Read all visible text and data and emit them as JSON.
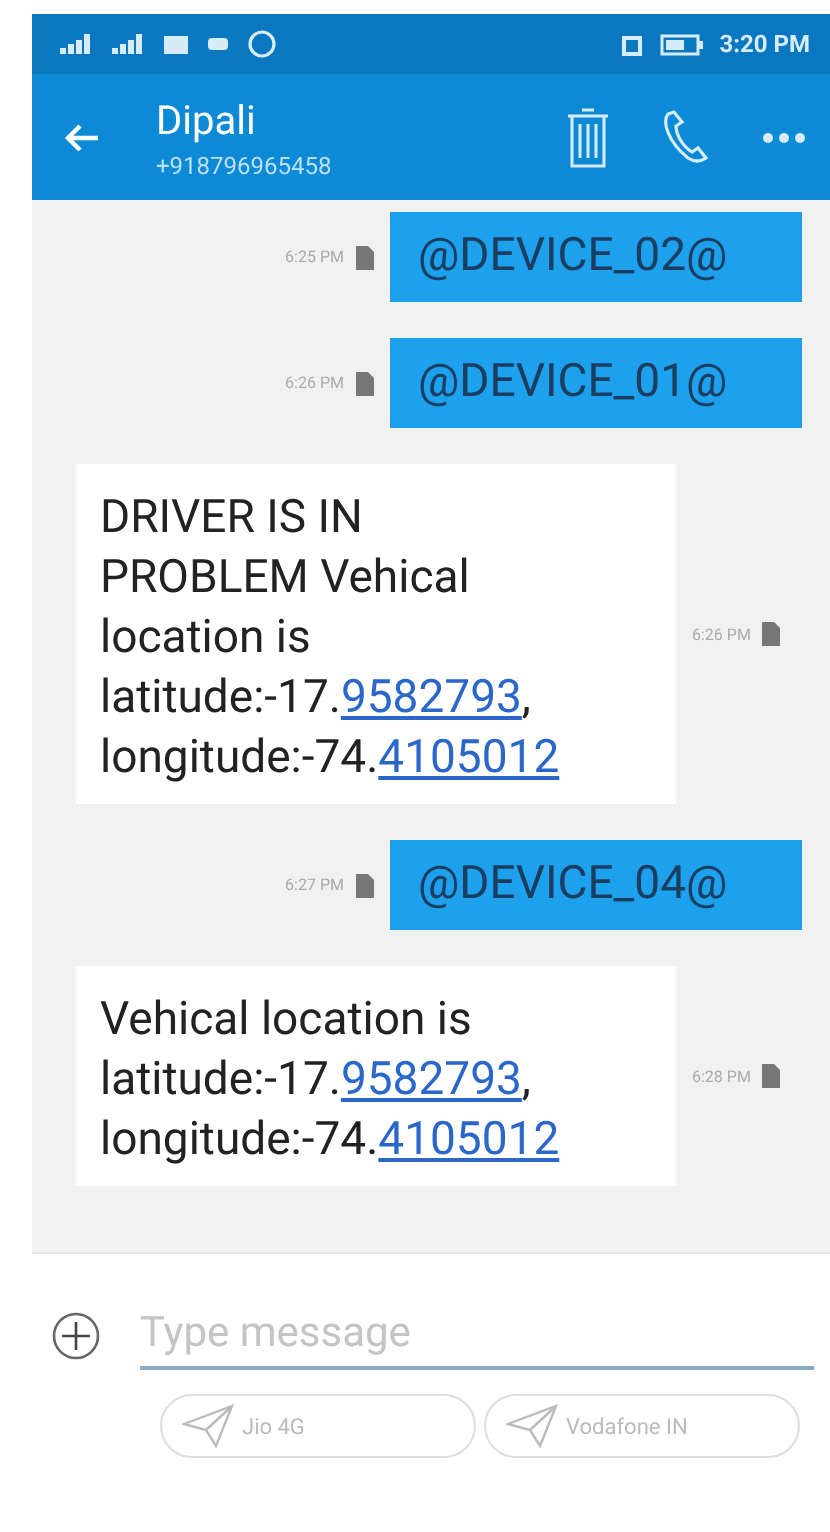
{
  "status_bar": {
    "time": "3:20 PM"
  },
  "header": {
    "name": "Dipali",
    "number": "+918796965458"
  },
  "messages": [
    {
      "kind": "sent",
      "time": "6:25 PM",
      "parts": [
        {
          "text": "@DEVICE_02@",
          "link": false
        }
      ]
    },
    {
      "kind": "sent",
      "time": "6:26 PM",
      "parts": [
        {
          "text": "@DEVICE_01@",
          "link": false
        }
      ]
    },
    {
      "kind": "received",
      "time": "6:26 PM",
      "parts": [
        {
          "text": " DRIVER IS IN PROBLEM Vehical location is latitude:-17.",
          "link": false
        },
        {
          "text": "9582793",
          "link": true
        },
        {
          "text": ", longitude:-74.",
          "link": false
        },
        {
          "text": "4105012",
          "link": true
        }
      ]
    },
    {
      "kind": "sent",
      "time": "6:27 PM",
      "parts": [
        {
          "text": "@DEVICE_04@",
          "link": false
        }
      ]
    },
    {
      "kind": "received",
      "time": "6:28 PM",
      "parts": [
        {
          "text": "Vehical location is latitude:-17.",
          "link": false
        },
        {
          "text": "9582793",
          "link": true
        },
        {
          "text": ", longitude:-74.",
          "link": false
        },
        {
          "text": "4105012",
          "link": true
        }
      ]
    }
  ],
  "composer": {
    "placeholder": "Type message"
  },
  "sim_buttons": [
    {
      "label": "Jio 4G"
    },
    {
      "label": "Vodafone IN"
    }
  ]
}
